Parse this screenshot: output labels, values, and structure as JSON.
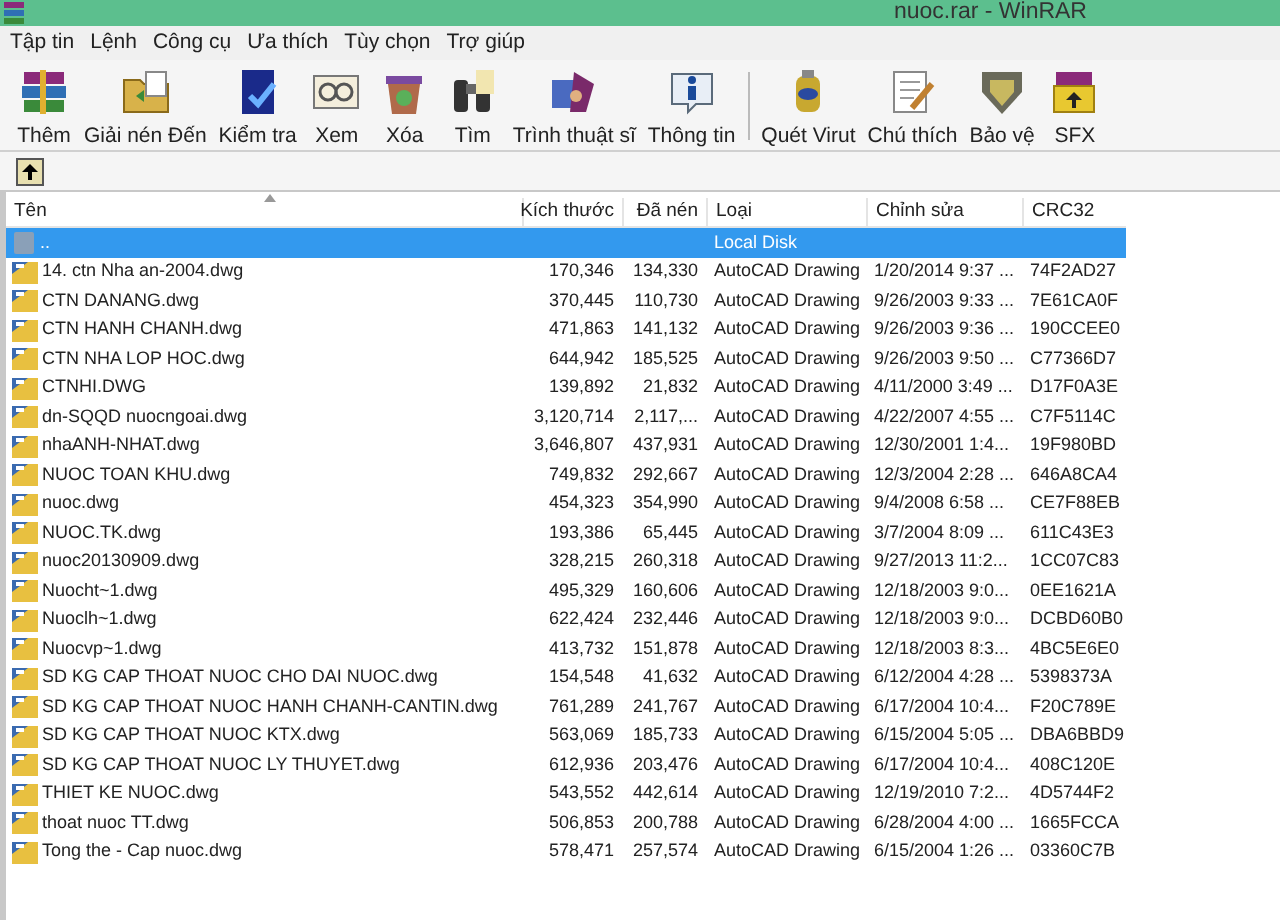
{
  "window": {
    "title": "nuoc.rar - WinRAR"
  },
  "menu": [
    "Tập tin",
    "Lệnh",
    "Công cụ",
    "Ưa thích",
    "Tùy chọn",
    "Trợ giúp"
  ],
  "toolbar": {
    "groups": [
      [
        {
          "label": "Thêm",
          "kind": "add"
        },
        {
          "label": "Giải nén Đến",
          "kind": "extract"
        },
        {
          "label": "Kiểm tra",
          "kind": "test"
        },
        {
          "label": "Xem",
          "kind": "view"
        },
        {
          "label": "Xóa",
          "kind": "delete"
        },
        {
          "label": "Tìm",
          "kind": "find"
        },
        {
          "label": "Trình thuật sĩ",
          "kind": "wizard"
        },
        {
          "label": "Thông tin",
          "kind": "info"
        }
      ],
      [
        {
          "label": "Quét Virut",
          "kind": "virus"
        },
        {
          "label": "Chú thích",
          "kind": "comment"
        },
        {
          "label": "Bảo vệ",
          "kind": "protect"
        },
        {
          "label": "SFX",
          "kind": "sfx"
        }
      ]
    ]
  },
  "table": {
    "columns": [
      {
        "label": "Tên",
        "sorted": true
      },
      {
        "label": "Kích thước",
        "sorted": false
      },
      {
        "label": "Đã nén",
        "sorted": false
      },
      {
        "label": "Loại",
        "sorted": false
      },
      {
        "label": "Chỉnh sửa",
        "sorted": false
      },
      {
        "label": "CRC32",
        "sorted": false
      }
    ],
    "rows": [
      {
        "kind": "parent",
        "selected": true,
        "cells": [
          "..",
          "",
          "",
          "Local Disk",
          "",
          ""
        ]
      },
      {
        "kind": "file",
        "selected": false,
        "cells": [
          "14. ctn Nha an-2004.dwg",
          "170,346",
          "134,330",
          "AutoCAD Drawing",
          "1/20/2014 9:37 ...",
          "74F2AD27"
        ]
      },
      {
        "kind": "file",
        "selected": false,
        "cells": [
          "CTN DANANG.dwg",
          "370,445",
          "110,730",
          "AutoCAD Drawing",
          "9/26/2003 9:33 ...",
          "7E61CA0F"
        ]
      },
      {
        "kind": "file",
        "selected": false,
        "cells": [
          "CTN HANH CHANH.dwg",
          "471,863",
          "141,132",
          "AutoCAD Drawing",
          "9/26/2003 9:36 ...",
          "190CCEE0"
        ]
      },
      {
        "kind": "file",
        "selected": false,
        "cells": [
          "CTN NHA LOP HOC.dwg",
          "644,942",
          "185,525",
          "AutoCAD Drawing",
          "9/26/2003 9:50 ...",
          "C77366D7"
        ]
      },
      {
        "kind": "file",
        "selected": false,
        "cells": [
          "CTNHI.DWG",
          "139,892",
          "21,832",
          "AutoCAD Drawing",
          "4/11/2000 3:49 ...",
          "D17F0A3E"
        ]
      },
      {
        "kind": "file",
        "selected": false,
        "cells": [
          "dn-SQQD nuocngoai.dwg",
          "3,120,714",
          "2,117,...",
          "AutoCAD Drawing",
          "4/22/2007 4:55 ...",
          "C7F5114C"
        ]
      },
      {
        "kind": "file",
        "selected": false,
        "cells": [
          "nhaANH-NHAT.dwg",
          "3,646,807",
          "437,931",
          "AutoCAD Drawing",
          "12/30/2001 1:4...",
          "19F980BD"
        ]
      },
      {
        "kind": "file",
        "selected": false,
        "cells": [
          "NUOC TOAN KHU.dwg",
          "749,832",
          "292,667",
          "AutoCAD Drawing",
          "12/3/2004 2:28 ...",
          "646A8CA4"
        ]
      },
      {
        "kind": "file",
        "selected": false,
        "cells": [
          "nuoc.dwg",
          "454,323",
          "354,990",
          "AutoCAD Drawing",
          "9/4/2008 6:58 ...",
          "CE7F88EB"
        ]
      },
      {
        "kind": "file",
        "selected": false,
        "cells": [
          "NUOC.TK.dwg",
          "193,386",
          "65,445",
          "AutoCAD Drawing",
          "3/7/2004 8:09 ...",
          "611C43E3"
        ]
      },
      {
        "kind": "file",
        "selected": false,
        "cells": [
          "nuoc20130909.dwg",
          "328,215",
          "260,318",
          "AutoCAD Drawing",
          "9/27/2013 11:2...",
          "1CC07C83"
        ]
      },
      {
        "kind": "file",
        "selected": false,
        "cells": [
          "Nuocht~1.dwg",
          "495,329",
          "160,606",
          "AutoCAD Drawing",
          "12/18/2003 9:0...",
          "0EE1621A"
        ]
      },
      {
        "kind": "file",
        "selected": false,
        "cells": [
          "Nuoclh~1.dwg",
          "622,424",
          "232,446",
          "AutoCAD Drawing",
          "12/18/2003 9:0...",
          "DCBD60B0"
        ]
      },
      {
        "kind": "file",
        "selected": false,
        "cells": [
          "Nuocvp~1.dwg",
          "413,732",
          "151,878",
          "AutoCAD Drawing",
          "12/18/2003 8:3...",
          "4BC5E6E0"
        ]
      },
      {
        "kind": "file",
        "selected": false,
        "cells": [
          "SD KG CAP THOAT NUOC CHO DAI NUOC.dwg",
          "154,548",
          "41,632",
          "AutoCAD Drawing",
          "6/12/2004 4:28 ...",
          "5398373A"
        ]
      },
      {
        "kind": "file",
        "selected": false,
        "cells": [
          "SD KG CAP THOAT NUOC HANH CHANH-CANTIN.dwg",
          "761,289",
          "241,767",
          "AutoCAD Drawing",
          "6/17/2004 10:4...",
          "F20C789E"
        ]
      },
      {
        "kind": "file",
        "selected": false,
        "cells": [
          "SD KG CAP THOAT NUOC KTX.dwg",
          "563,069",
          "185,733",
          "AutoCAD Drawing",
          "6/15/2004 5:05 ...",
          "DBA6BBD9"
        ]
      },
      {
        "kind": "file",
        "selected": false,
        "cells": [
          "SD KG CAP THOAT NUOC LY THUYET.dwg",
          "612,936",
          "203,476",
          "AutoCAD Drawing",
          "6/17/2004 10:4...",
          "408C120E"
        ]
      },
      {
        "kind": "file",
        "selected": false,
        "cells": [
          "THIET KE NUOC.dwg",
          "543,552",
          "442,614",
          "AutoCAD Drawing",
          "12/19/2010 7:2...",
          "4D5744F2"
        ]
      },
      {
        "kind": "file",
        "selected": false,
        "cells": [
          "thoat nuoc TT.dwg",
          "506,853",
          "200,788",
          "AutoCAD Drawing",
          "6/28/2004 4:00 ...",
          "1665FCCA"
        ]
      },
      {
        "kind": "file",
        "selected": false,
        "cells": [
          "Tong the - Cap nuoc.dwg",
          "578,471",
          "257,574",
          "AutoCAD Drawing",
          "6/15/2004 1:26 ...",
          "03360C7B"
        ]
      }
    ]
  }
}
